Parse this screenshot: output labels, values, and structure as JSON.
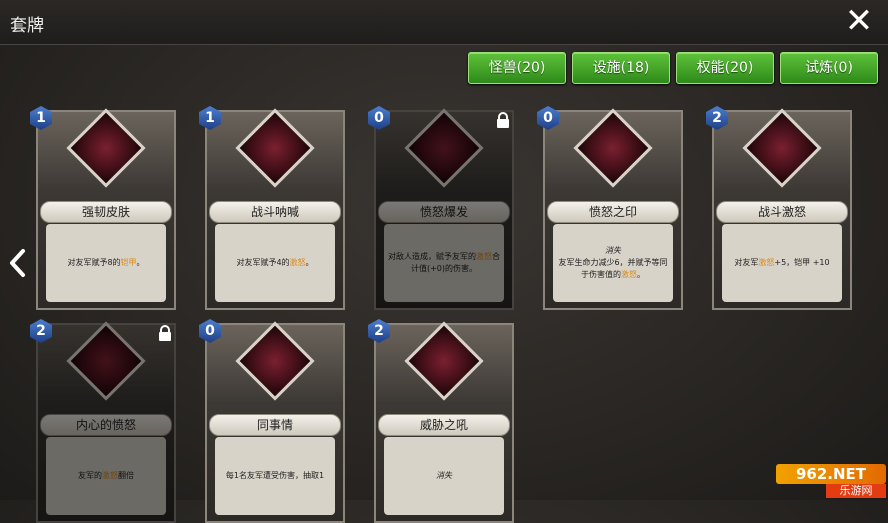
{
  "header": {
    "title": "套牌",
    "close_label": "✕"
  },
  "filters": [
    {
      "label": "怪兽(20)"
    },
    {
      "label": "设施(18)"
    },
    {
      "label": "权能(20)"
    },
    {
      "label": "试炼(0)"
    }
  ],
  "cards": [
    {
      "cost": "1",
      "name": "强韧皮肤",
      "desc_pre": "对友军赋予8的",
      "desc_hl": "铠甲",
      "desc_post": "。",
      "italic": "",
      "locked": false
    },
    {
      "cost": "1",
      "name": "战斗呐喊",
      "desc_pre": "对友军赋予4的",
      "desc_hl": "激怒",
      "desc_post": "。",
      "italic": "",
      "locked": false
    },
    {
      "cost": "0",
      "name": "愤怒爆发",
      "desc_pre": "对敌人造成，赋予友军的",
      "desc_hl": "激怒",
      "desc_post": "合计值(+0)的伤害。",
      "italic": "",
      "locked": true
    },
    {
      "cost": "0",
      "name": "愤怒之印",
      "desc_pre": "友军生命力减少6，并赋予等同于伤害值的",
      "desc_hl": "激怒",
      "desc_post": "。",
      "italic": "消失",
      "locked": false
    },
    {
      "cost": "2",
      "name": "战斗激怒",
      "desc_pre": "对友军",
      "desc_hl": "激怒",
      "desc_post": "+5，铠甲 +10",
      "italic": "",
      "locked": false
    },
    {
      "cost": "2",
      "name": "内心的愤怒",
      "desc_pre": "友军的",
      "desc_hl": "激怒",
      "desc_post": "翻倍",
      "italic": "",
      "locked": true
    },
    {
      "cost": "0",
      "name": "同事情",
      "desc_pre": "每1名友军遭受伤害，抽取1",
      "desc_hl": "",
      "desc_post": "",
      "italic": "",
      "locked": false
    },
    {
      "cost": "2",
      "name": "威胁之吼",
      "desc_pre": "",
      "desc_hl": "",
      "desc_post": "",
      "italic": "消失",
      "locked": false
    }
  ],
  "watermark": {
    "main": "962.NET",
    "sub": "乐游网"
  }
}
